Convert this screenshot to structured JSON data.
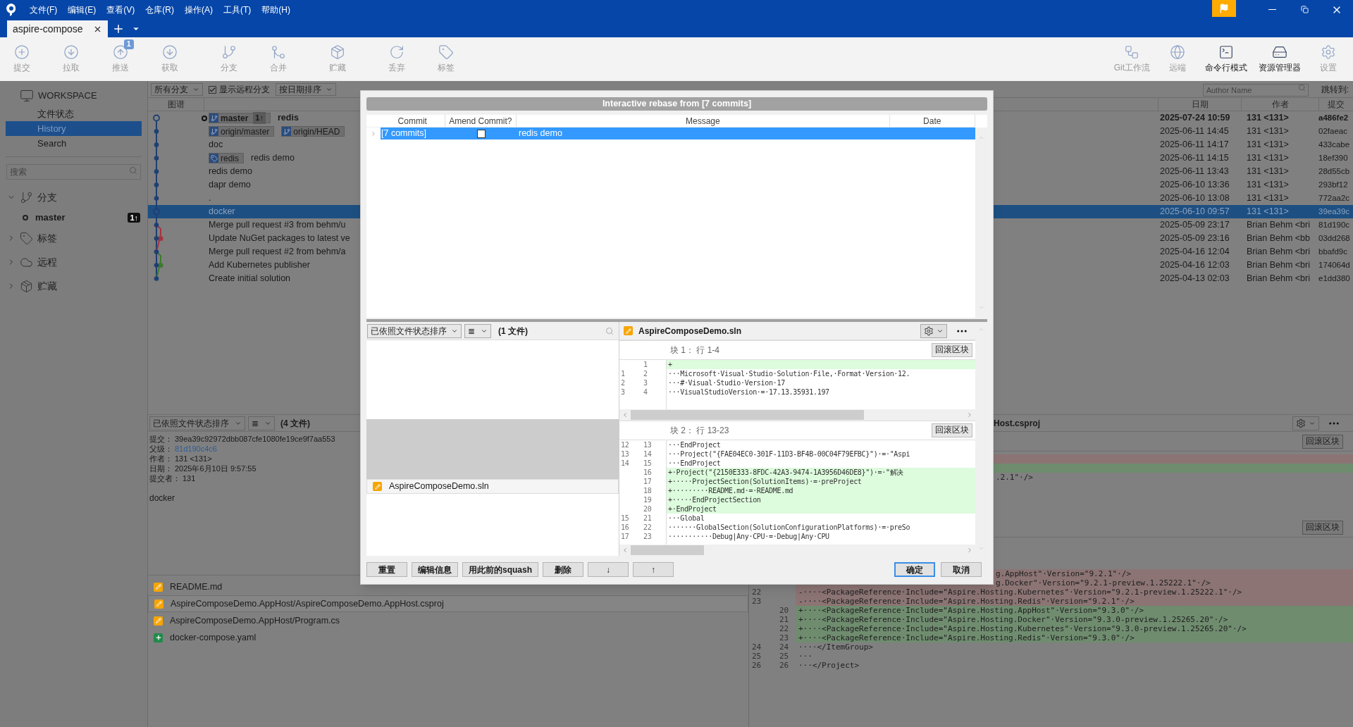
{
  "app": {
    "menu": [
      "文件(F)",
      "编辑(E)",
      "查看(V)",
      "仓库(R)",
      "操作(A)",
      "工具(T)",
      "帮助(H)"
    ],
    "tabs": [
      {
        "label": "aspire-compose",
        "selected": true
      }
    ]
  },
  "toolbar": {
    "left": [
      {
        "label": "提交",
        "disabled": true
      },
      {
        "label": "拉取",
        "disabled": true
      },
      {
        "label": "推送",
        "disabled": true,
        "badge": "1"
      },
      {
        "label": "获取",
        "disabled": true
      },
      {
        "label": "分支",
        "disabled": true
      },
      {
        "label": "合并",
        "disabled": true
      },
      {
        "label": "贮藏",
        "disabled": true
      },
      {
        "label": "丢弃",
        "disabled": true
      },
      {
        "label": "标签",
        "disabled": true
      }
    ],
    "right": [
      {
        "label": "Git工作流",
        "disabled": true
      },
      {
        "label": "远端",
        "disabled": true
      },
      {
        "label": "命令行模式",
        "disabled": false
      },
      {
        "label": "资源管理器",
        "disabled": false
      },
      {
        "label": "设置",
        "disabled": true
      }
    ]
  },
  "sidebar": {
    "workspace": "WORKSPACE",
    "items": [
      {
        "label": "文件状态",
        "selected": false
      },
      {
        "label": "History",
        "selected": true
      },
      {
        "label": "Search",
        "selected": false
      }
    ],
    "search": {
      "placeholder": "搜索"
    },
    "groups": [
      {
        "label": "分支",
        "expanded": true,
        "children": [
          {
            "label": "master",
            "badge": "1↑"
          }
        ]
      },
      {
        "label": "标签",
        "expanded": false
      },
      {
        "label": "远程",
        "expanded": false
      },
      {
        "label": "贮藏",
        "expanded": false
      }
    ]
  },
  "history": {
    "filters": {
      "branches": "所有分支",
      "show_remote": {
        "label": "显示远程分支",
        "checked": true
      },
      "sort": "按日期排序",
      "author_placeholder": "Author Name",
      "jump": "跳转到:"
    },
    "columns": {
      "graph": "图谱",
      "date": "日期",
      "author": "作者",
      "commit": "提交"
    },
    "rows": [
      {
        "current": true,
        "selected": false,
        "refs": [
          {
            "kind": "branch",
            "label": "master",
            "badge": "1↑"
          }
        ],
        "message": "redis",
        "date": "2025-07-24 10:59",
        "author": "131 <131>",
        "commit": "a486fe2"
      },
      {
        "current": false,
        "selected": false,
        "refs": [
          {
            "kind": "remote",
            "label": "origin/master"
          },
          {
            "kind": "remote",
            "label": "origin/HEAD"
          }
        ],
        "date": "2025-06-11 14:45",
        "author": "131 <131>",
        "commit": "02faeac"
      },
      {
        "current": false,
        "selected": false,
        "message": "doc",
        "date": "2025-06-11 14:17",
        "author": "131 <131>",
        "commit": "433cabe"
      },
      {
        "current": false,
        "selected": false,
        "refs": [
          {
            "kind": "tag",
            "label": "redis"
          }
        ],
        "message": "redis demo",
        "date": "2025-06-11 14:15",
        "author": "131 <131>",
        "commit": "18ef390"
      },
      {
        "current": false,
        "selected": false,
        "message": "redis demo",
        "date": "2025-06-11 13:43",
        "author": "131 <131>",
        "commit": "28d55cb"
      },
      {
        "current": false,
        "selected": false,
        "message": "dapr demo",
        "date": "2025-06-10 13:36",
        "author": "131 <131>",
        "commit": "293bf12"
      },
      {
        "current": false,
        "selected": false,
        "message": ".",
        "date": "2025-06-10 13:08",
        "author": "131 <131>",
        "commit": "772aa2c"
      },
      {
        "current": false,
        "selected": true,
        "message": "docker",
        "date": "2025-06-10 09:57",
        "author": "131 <131>",
        "commit": "39ea39c"
      },
      {
        "current": false,
        "selected": false,
        "message": "Merge pull request #3 from behm/u",
        "date": "2025-05-09 23:17",
        "author": "Brian Behm <bri",
        "commit": "81d190c"
      },
      {
        "current": false,
        "selected": false,
        "message": "Update NuGet packages to latest ve",
        "date": "2025-05-09 23:16",
        "author": "Brian Behm <bb",
        "commit": "03dd268"
      },
      {
        "current": false,
        "selected": false,
        "message": "Merge pull request #2 from behm/a",
        "date": "2025-04-16 12:04",
        "author": "Brian Behm <bri",
        "commit": "bbafd9c"
      },
      {
        "current": false,
        "selected": false,
        "message": "Add Kubernetes publisher",
        "date": "2025-04-16 12:03",
        "author": "Brian Behm <bri",
        "commit": "174064d"
      },
      {
        "current": false,
        "selected": false,
        "message": "Create initial solution",
        "date": "2025-04-13 02:03",
        "author": "Brian Behm <bri",
        "commit": "e1dd380"
      }
    ]
  },
  "details": {
    "sort": "已依照文件状态排序",
    "view": "≣",
    "count": "(4 文件)",
    "fields": [
      {
        "label": "提交：",
        "value": "39ea39c92972dbb087cfe1080fe19ce9f7aa553",
        "kind": "text"
      },
      {
        "label": "父级：",
        "value": "81d190c4c6",
        "kind": "link"
      },
      {
        "label": "作者：",
        "value": "131 <131>",
        "kind": "text"
      },
      {
        "label": "日期：",
        "value": "2025年6月10日 9:57:55",
        "kind": "text"
      },
      {
        "label": "提交者：",
        "value": "131",
        "kind": "text"
      }
    ],
    "message": "docker",
    "files": [
      {
        "name": "README.md",
        "kind": "modified",
        "selected": false
      },
      {
        "name": "AspireComposeDemo.AppHost/AspireComposeDemo.AppHost.csproj",
        "kind": "modified",
        "selected": true
      },
      {
        "name": "AspireComposeDemo.AppHost/Program.cs",
        "kind": "modified",
        "selected": false
      },
      {
        "name": "docker-compose.yaml",
        "kind": "added",
        "selected": false
      }
    ]
  },
  "diff": {
    "file": "Host.csproj",
    "hunks": [
      {
        "rollback": "回滚区块",
        "lines": [
          {
            "kind": "removed"
          },
          {
            "kind": "added"
          },
          {
            "kind": "partial",
            "text": ".2.1\"·/>"
          }
        ]
      },
      {
        "rollback": "回滚区块",
        "lines": [
          {
            "kind": "partial_removed",
            "text": "g.AppHost\"·Version=\"9.2.1\"·/>"
          },
          {
            "kind": "partial_removed",
            "text": "g.Docker\"·Version=\"9.2.1-preview.1.25222.1\"·/>"
          },
          {
            "kind": "removed",
            "old": "22",
            "text": "-····<PackageReference·Include=\"Aspire.Hosting.Kubernetes\"·Version=\"9.2.1-preview.1.25222.1\"·/>"
          },
          {
            "kind": "removed",
            "old": "23",
            "text": "-····<PackageReference·Include=\"Aspire.Hosting.Redis\"·Version=\"9.2.1\"·/>"
          },
          {
            "kind": "added",
            "new": "20",
            "text": "+····<PackageReference·Include=\"Aspire.Hosting.AppHost\"·Version=\"9.3.0\"·/>"
          },
          {
            "kind": "added",
            "new": "21",
            "text": "+····<PackageReference·Include=\"Aspire.Hosting.Docker\"·Version=\"9.3.0-preview.1.25265.20\"·/>"
          },
          {
            "kind": "added",
            "new": "22",
            "text": "+····<PackageReference·Include=\"Aspire.Hosting.Kubernetes\"·Version=\"9.3.0-preview.1.25265.20\"·/>"
          },
          {
            "kind": "added",
            "new": "23",
            "text": "+····<PackageReference·Include=\"Aspire.Hosting.Redis\"·Version=\"9.3.0\"·/>"
          },
          {
            "kind": "context",
            "old": "24",
            "new": "24",
            "text": "····</ItemGroup>"
          },
          {
            "kind": "context",
            "old": "25",
            "new": "25",
            "text": "···"
          },
          {
            "kind": "context",
            "old": "26",
            "new": "26",
            "text": "···</Project>"
          }
        ]
      }
    ]
  },
  "rebase_dialog": {
    "title": "Interactive rebase from [7 commits]",
    "columns": [
      "Commit",
      "Amend Commit?",
      "Message",
      "Date"
    ],
    "rows": [
      {
        "commit": "[7 commits]",
        "amend": false,
        "message": "redis demo",
        "selected": true
      }
    ],
    "files_toolbar": {
      "sort": "已依照文件状态排序",
      "view": "≣",
      "count": "(1 文件)"
    },
    "files": [
      {
        "name": "AspireComposeDemo.sln",
        "kind": "modified",
        "selected": true
      }
    ],
    "diff": {
      "file": "AspireComposeDemo.sln",
      "hunks": [
        {
          "title": "块 1： 行 1-4",
          "rollback": "回滚区块",
          "lines": [
            {
              "kind": "added",
              "new": "1",
              "text": "+"
            },
            {
              "kind": "context",
              "old": "1",
              "new": "2",
              "text": "···Microsoft·Visual·Studio·Solution·File,·Format·Version·12."
            },
            {
              "kind": "context",
              "old": "2",
              "new": "3",
              "text": "···#·Visual·Studio·Version·17"
            },
            {
              "kind": "context",
              "old": "3",
              "new": "4",
              "text": "···VisualStudioVersion·=·17.13.35931.197"
            }
          ]
        },
        {
          "title": "块 2： 行 13-23",
          "rollback": "回滚区块",
          "lines": [
            {
              "kind": "context",
              "old": "12",
              "new": "13",
              "text": "···EndProject"
            },
            {
              "kind": "context",
              "old": "13",
              "new": "14",
              "text": "···Project(\"{FAE04EC0-301F-11D3-BF4B-00C04F79EFBC}\")·=·\"Aspi"
            },
            {
              "kind": "context",
              "old": "14",
              "new": "15",
              "text": "···EndProject"
            },
            {
              "kind": "added",
              "new": "16",
              "text": "+·Project(\"{2150E333-8FDC-42A3-9474-1A3956D46DE8}\")·=·\"解决"
            },
            {
              "kind": "added",
              "new": "17",
              "text": "+·····ProjectSection(SolutionItems)·=·preProject"
            },
            {
              "kind": "added",
              "new": "18",
              "text": "+·········README.md·=·README.md"
            },
            {
              "kind": "added",
              "new": "19",
              "text": "+·····EndProjectSection"
            },
            {
              "kind": "added",
              "new": "20",
              "text": "+·EndProject"
            },
            {
              "kind": "context",
              "old": "15",
              "new": "21",
              "text": "···Global"
            },
            {
              "kind": "context",
              "old": "16",
              "new": "22",
              "text": "·······GlobalSection(SolutionConfigurationPlatforms)·=·preSo"
            },
            {
              "kind": "context",
              "old": "17",
              "new": "23",
              "text": "···········Debug|Any·CPU·=·Debug|Any·CPU"
            }
          ]
        }
      ]
    },
    "actions": [
      "重置",
      "编辑信息",
      "用此前的squash",
      "删除",
      "↓",
      "↑"
    ],
    "confirm": "确定",
    "cancel": "取消"
  }
}
